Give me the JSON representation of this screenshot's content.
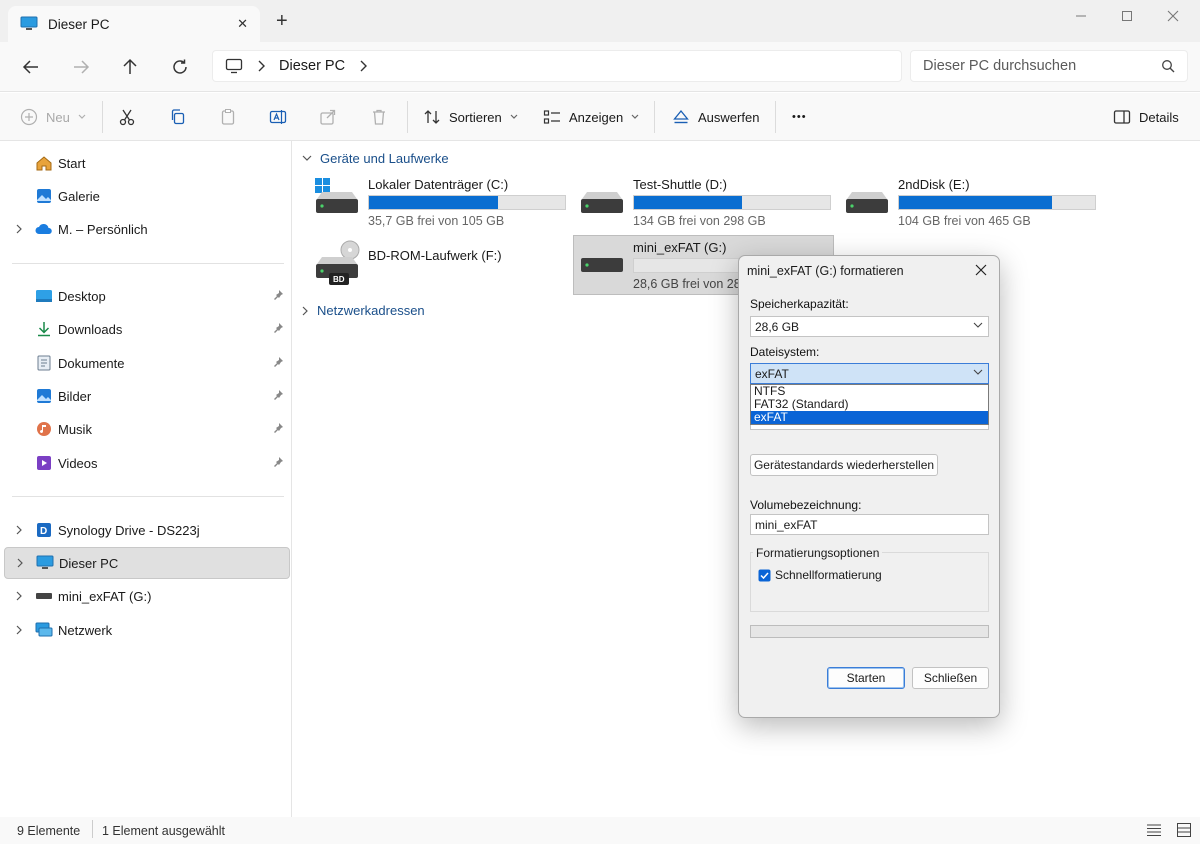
{
  "window": {
    "tab_title": "Dieser PC",
    "new_tab": "+",
    "close_tab": "✕"
  },
  "address": {
    "location": "Dieser PC",
    "search_placeholder": "Dieser PC durchsuchen"
  },
  "toolbar": {
    "new_label": "Neu",
    "sort_label": "Sortieren",
    "view_label": "Anzeigen",
    "eject_label": "Auswerfen",
    "more_label": "•••",
    "details_label": "Details"
  },
  "sidebar": {
    "items": [
      {
        "label": "Start"
      },
      {
        "label": "Galerie"
      },
      {
        "label": "M. – Persönlich"
      },
      {
        "label": "Desktop"
      },
      {
        "label": "Downloads"
      },
      {
        "label": "Dokumente"
      },
      {
        "label": "Bilder"
      },
      {
        "label": "Musik"
      },
      {
        "label": "Videos"
      },
      {
        "label": "Synology Drive - DS223j"
      },
      {
        "label": "Dieser PC"
      },
      {
        "label": "mini_exFAT (G:)"
      },
      {
        "label": "Netzwerk"
      }
    ]
  },
  "main": {
    "group_devices": "Geräte und Laufwerke",
    "group_network": "Netzwerkadressen",
    "drives": [
      {
        "name": "Lokaler Datenträger (C:)",
        "free": "35,7 GB frei von 105 GB",
        "used_fraction": 0.66
      },
      {
        "name": "Test-Shuttle (D:)",
        "free": "134 GB frei von 298 GB",
        "used_fraction": 0.55
      },
      {
        "name": "2ndDisk (E:)",
        "free": "104 GB frei von 465 GB",
        "used_fraction": 0.78
      },
      {
        "name": "BD-ROM-Laufwerk (F:)",
        "badge": "BD"
      },
      {
        "name": "mini_exFAT (G:)",
        "free": "28,6 GB frei von 28",
        "used_fraction": 0.0
      }
    ]
  },
  "dialog": {
    "title": "mini_exFAT (G:) formatieren",
    "capacity_label": "Speicherkapazität:",
    "capacity_value": "28,6 GB",
    "fs_label": "Dateisystem:",
    "fs_value": "exFAT",
    "fs_options": [
      "NTFS",
      "FAT32 (Standard)",
      "exFAT"
    ],
    "restore_button": "Gerätestandards wiederherstellen",
    "volume_label": "Volumebezeichnung:",
    "volume_value": "mini_exFAT",
    "options_legend": "Formatierungsoptionen",
    "quick_format": "Schnellformatierung",
    "quick_format_checked": true,
    "start_button": "Starten",
    "close_button": "Schließen"
  },
  "status": {
    "count": "9 Elemente",
    "selected": "1 Element ausgewählt"
  },
  "colors": {
    "accent": "#0a6ed1",
    "selection": "#0a64d6"
  }
}
